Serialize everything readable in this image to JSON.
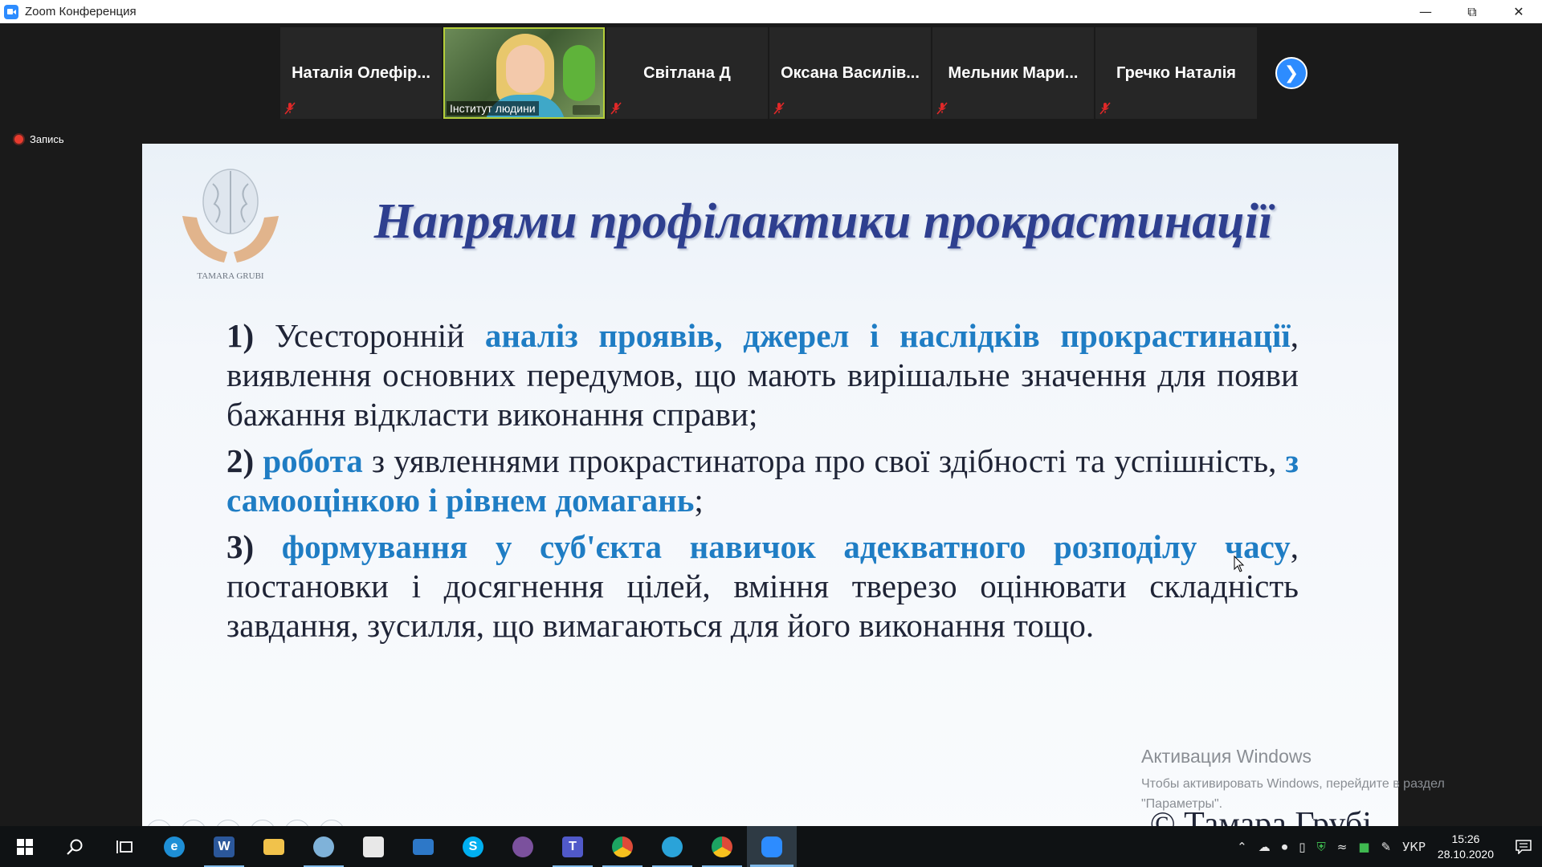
{
  "window": {
    "title": "Zoom Конференция",
    "controls": [
      "minimize",
      "restore",
      "close"
    ]
  },
  "participants": [
    {
      "name": "Наталія  Олефір...",
      "muted": true,
      "video": false
    },
    {
      "name": "Інститут людини",
      "muted": true,
      "video": true
    },
    {
      "name": "Світлана Д",
      "muted": false,
      "video": false
    },
    {
      "name": "Оксана  Василів...",
      "muted": true,
      "video": false
    },
    {
      "name": "Мельник  Мари...",
      "muted": true,
      "video": false
    },
    {
      "name": "Гречко Наталія",
      "muted": true,
      "video": false
    }
  ],
  "recording": {
    "label": "Запись",
    "color": "#e83b2e"
  },
  "slide": {
    "logo_text": "TAMARA GRUBI",
    "title": "Напрями профілактики прокрастинації",
    "items": [
      {
        "num": "1)",
        "pre": " Усесторонній ",
        "highlight": "аналіз проявів, джерел і наслідків прокрастинації",
        "post": ", виявлення основних передумов, що мають вирішальне значення для появи бажання відкласти виконання справи;"
      },
      {
        "num": "2)",
        "pre": " ",
        "highlight": "робота",
        "mid": " з уявленнями прокрастинатора про свої здібності та успішність, ",
        "highlight2": "з самооцінкою і рівнем домагань",
        "post": ";"
      },
      {
        "num": "3)",
        "pre": " ",
        "highlight": "формування у суб'єкта навичок адекватного розподілу часу",
        "post": ", постановки і досягнення цілей, вміння тверезо оцінювати складність завдання, зусилля, що вимагаються для його виконання тощо."
      }
    ],
    "copyright": "© Тамара Грубі",
    "nav_icons": [
      "prev-icon",
      "next-icon",
      "pen-icon",
      "slides-icon",
      "zoom-icon",
      "more-icon"
    ]
  },
  "activation": {
    "title": "Активация Windows",
    "text1": "Чтобы активировать Windows, перейдите в раздел",
    "text2": "\"Параметры\"."
  },
  "taskbar": {
    "apps": [
      {
        "name": "start",
        "icon": "windows-icon"
      },
      {
        "name": "search",
        "icon": "search-icon"
      },
      {
        "name": "task-view",
        "icon": "task-view-icon"
      },
      {
        "name": "edge",
        "icon": "edge-icon",
        "letter": "e",
        "color": "#1e8fd6"
      },
      {
        "name": "word",
        "icon": "word-icon",
        "letter": "W",
        "color": "#2b579a"
      },
      {
        "name": "explorer",
        "icon": "folder-icon",
        "letter": "",
        "color": "#f1c24b"
      },
      {
        "name": "paint",
        "icon": "paint-icon",
        "letter": "",
        "color": "#7fb2d9"
      },
      {
        "name": "store",
        "icon": "store-icon",
        "letter": "",
        "color": "#e8e8e8"
      },
      {
        "name": "mail",
        "icon": "mail-icon",
        "letter": "",
        "color": "#2d78c8"
      },
      {
        "name": "skype",
        "icon": "skype-icon",
        "letter": "S",
        "color": "#00aff0"
      },
      {
        "name": "viber",
        "icon": "viber-icon",
        "letter": "",
        "color": "#7b519d"
      },
      {
        "name": "teams",
        "icon": "teams-icon",
        "letter": "T",
        "color": "#5059c9"
      },
      {
        "name": "chrome",
        "icon": "chrome-icon",
        "letter": "",
        "color": "#dd4b39"
      },
      {
        "name": "telegram",
        "icon": "telegram-icon",
        "letter": "",
        "color": "#2aa3d9"
      },
      {
        "name": "chrome-2",
        "icon": "chrome-icon",
        "letter": "",
        "color": "#dd4b39"
      },
      {
        "name": "zoom",
        "icon": "zoom-icon",
        "letter": "",
        "color": "#2d8cff"
      }
    ],
    "language": "УКР",
    "time": "15:26",
    "date": "28.10.2020"
  }
}
